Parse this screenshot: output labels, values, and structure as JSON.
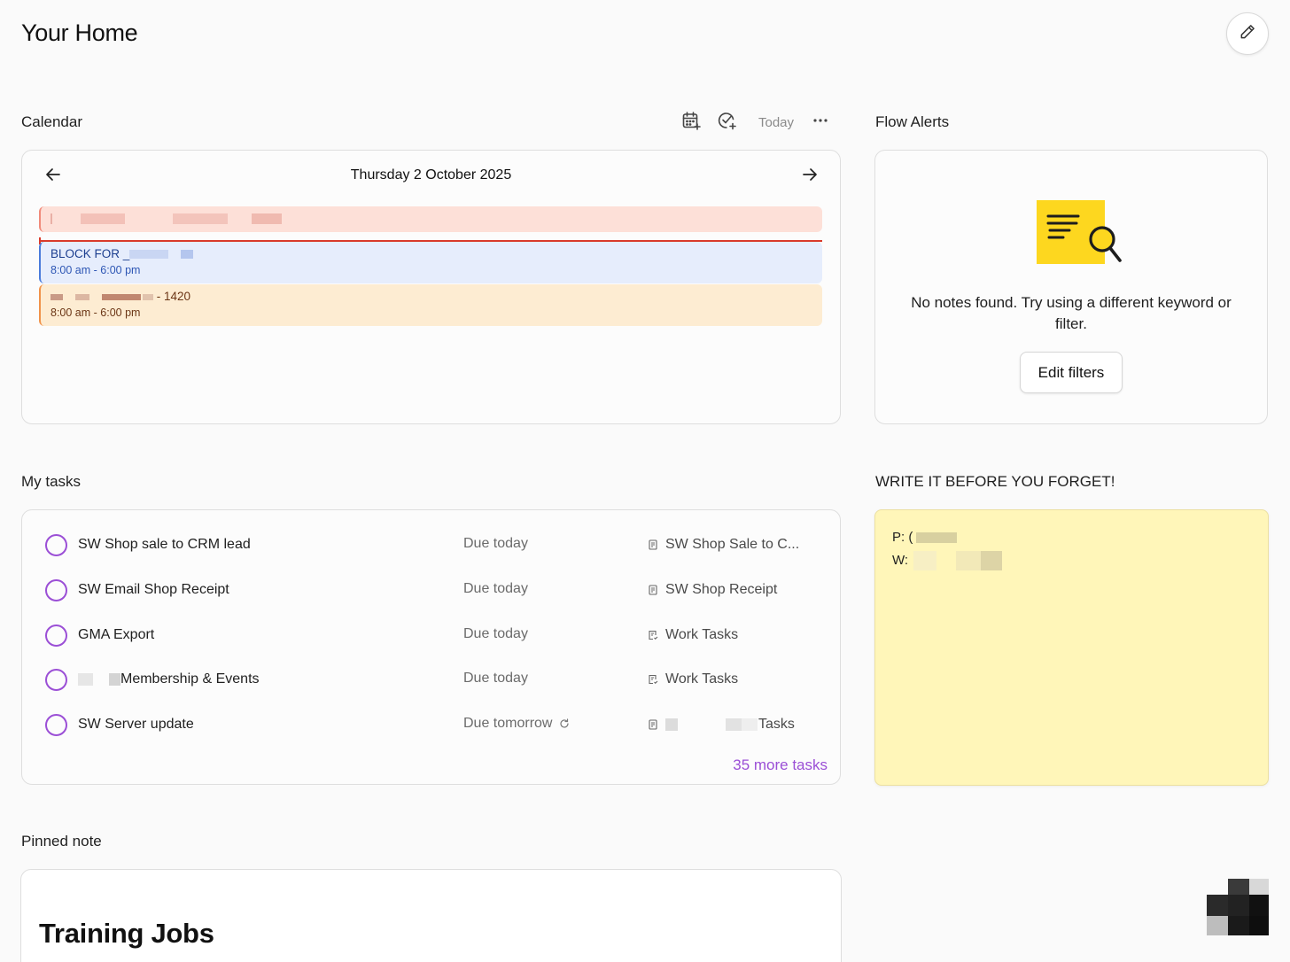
{
  "header": {
    "title": "Your Home",
    "edit_icon": "pencil-icon"
  },
  "calendar": {
    "section_title": "Calendar",
    "toolbar": {
      "add_event_icon": "calendar-plus-icon",
      "add_task_icon": "check-circle-plus-icon",
      "today_label": "Today",
      "more_icon": "ellipsis-icon"
    },
    "date": "Thursday 2 October 2025",
    "prev_icon": "arrow-left-icon",
    "next_icon": "arrow-right-icon",
    "events": [
      {
        "title": "",
        "time": "",
        "color": "#fde0d8",
        "accent": "#f08a7a"
      },
      {
        "title": "BLOCK FOR _",
        "time": "8:00 am - 6:00 pm",
        "color": "#e6edfc",
        "accent": "#4a7bdb"
      },
      {
        "title": "- 1420",
        "time": "8:00 am - 6:00 pm",
        "color": "#fdecd2",
        "accent": "#f0924a"
      }
    ]
  },
  "flow_alerts": {
    "section_title": "Flow Alerts",
    "illustration_icon": "note-search-icon",
    "empty_message": "No notes found. Try using a different keyword or filter.",
    "edit_filters_label": "Edit filters"
  },
  "tasks": {
    "section_title": "My tasks",
    "items": [
      {
        "name": "SW Shop sale to CRM lead",
        "due": "Due today",
        "project": "SW Shop Sale to C...",
        "project_icon": "note-icon"
      },
      {
        "name": "SW Email Shop Receipt",
        "due": "Due today",
        "project": "SW Shop Receipt",
        "project_icon": "note-icon"
      },
      {
        "name": "GMA Export",
        "due": "Due today",
        "project": "Work Tasks",
        "project_icon": "checklist-icon"
      },
      {
        "name": "Membership & Events",
        "due": "Due today",
        "project": "Work Tasks",
        "project_icon": "checklist-icon"
      },
      {
        "name": "SW Server update",
        "due": "Due tomorrow",
        "project": "Tasks",
        "project_icon": "note-icon",
        "repeat_icon": "repeat-icon"
      }
    ],
    "more_label": "35 more tasks",
    "accent": "#9b4fd6"
  },
  "sticky": {
    "section_title": "WRITE IT BEFORE YOU FORGET!",
    "line1": "P: (",
    "line2": "W:",
    "color": "#fff6b9"
  },
  "pinned": {
    "section_title": "Pinned note",
    "note_title": "Training Jobs"
  }
}
